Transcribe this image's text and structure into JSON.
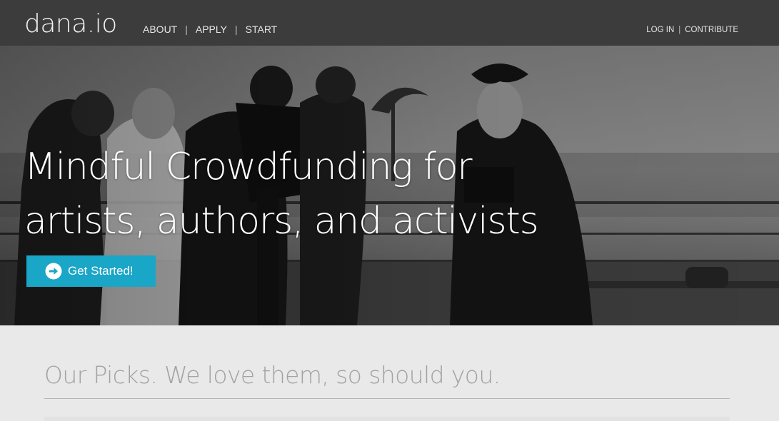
{
  "header": {
    "logo": "dana.io",
    "nav_left": [
      {
        "label": "ABOUT"
      },
      {
        "label": "APPLY"
      },
      {
        "label": "START"
      }
    ],
    "nav_right": [
      {
        "label": "LOG IN"
      },
      {
        "label": "CONTRIBUTE"
      }
    ],
    "separator": "|"
  },
  "hero": {
    "title_line1": "Mindful Crowdfunding for",
    "title_line2": "artists, authors, and activists",
    "cta_label": "Get Started!",
    "cta_icon": "arrow-right-circle-icon",
    "photo_icon": "film-crew-photo"
  },
  "picks": {
    "heading": "Our Picks. We love them, so should you."
  },
  "colors": {
    "topbar": "#3c3c3c",
    "accent": "#1aa6c6",
    "section_bg": "#e9e9e9",
    "heading_gray": "#a2a2a2"
  }
}
